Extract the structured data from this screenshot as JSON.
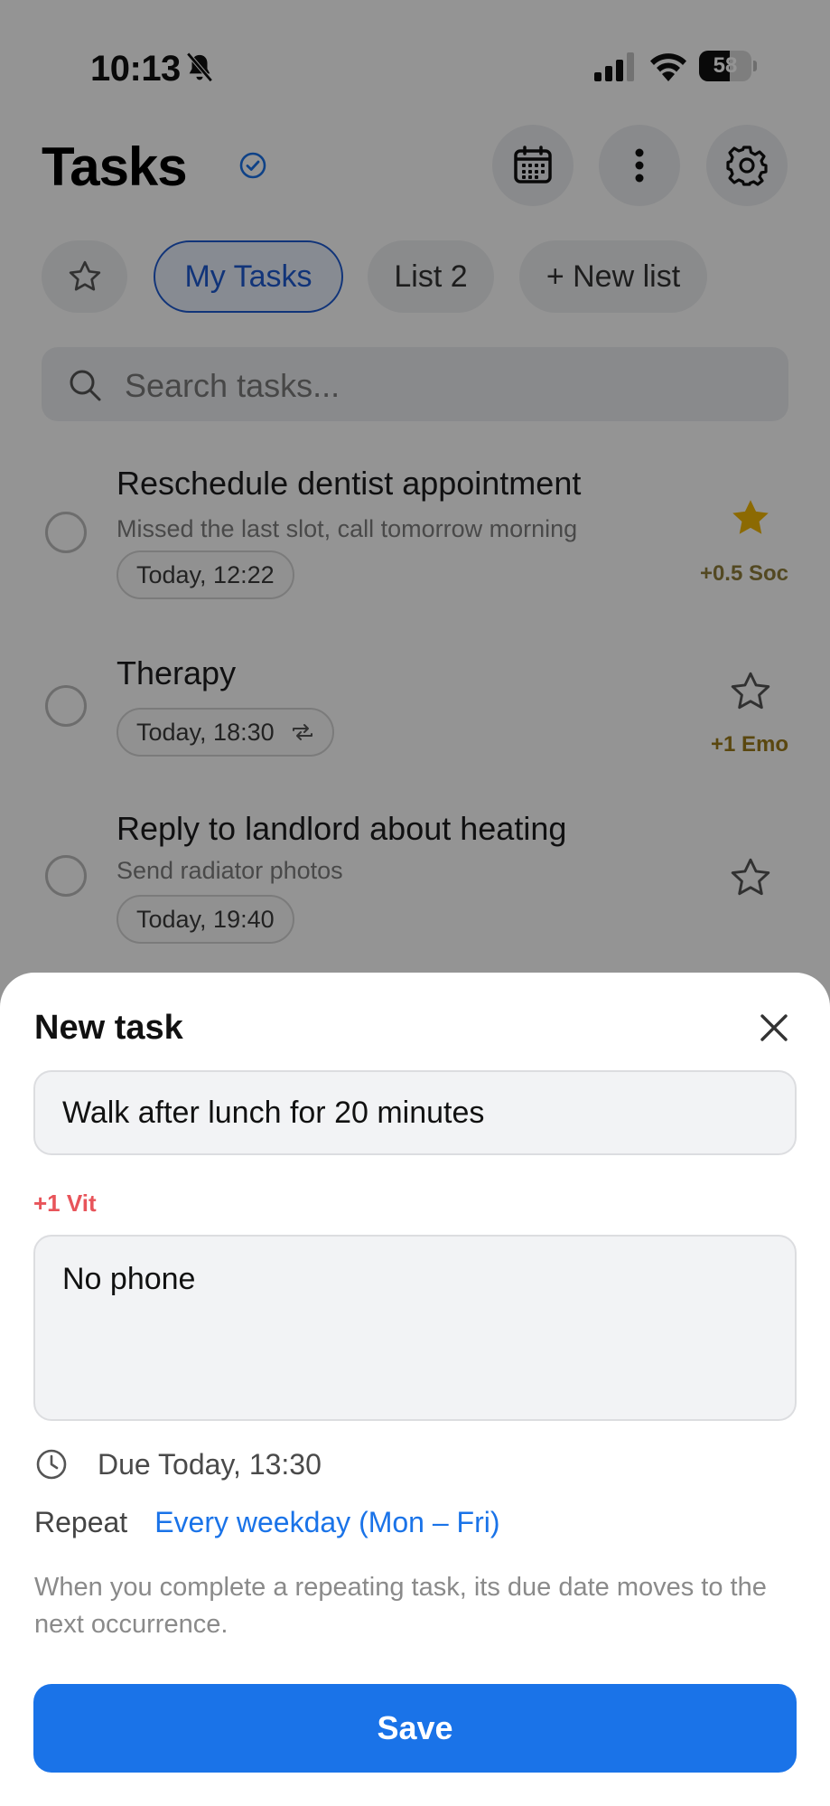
{
  "status_bar": {
    "time": "10:13",
    "battery_percent": "58",
    "battery_level": 0.58
  },
  "header": {
    "title": "Tasks"
  },
  "lists": {
    "favorites_icon": "star-outline-icon",
    "items": [
      {
        "label": "My Tasks",
        "active": true
      },
      {
        "label": "List 2",
        "active": false
      }
    ],
    "new_list_label": "+ New list"
  },
  "search": {
    "placeholder": "Search tasks..."
  },
  "tasks": [
    {
      "title": "Reschedule dentist appointment",
      "note": "Missed the last slot, call tomorrow morning",
      "due": "Today, 12:22",
      "starred": true,
      "reward": "+0.5 Soc",
      "reward_color": "#8f7e3c"
    },
    {
      "title": "Therapy",
      "note": "",
      "due": "Today, 18:30",
      "repeats": true,
      "starred": false,
      "reward": "+1 Emo",
      "reward_color": "#9b7a1a"
    },
    {
      "title": "Reply to landlord about heating",
      "note": "Send radiator photos",
      "due": "Today, 19:40",
      "starred": false,
      "reward": ""
    }
  ],
  "new_task_sheet": {
    "title": "New task",
    "task_title_value": "Walk after lunch for 20 minutes",
    "reward_tag": "+1 Vit",
    "notes_value": "No phone",
    "due_text": "Due Today, 13:30",
    "repeat_label": "Repeat",
    "repeat_value": "Every weekday (Mon – Fri)",
    "repeat_help": "When you complete a repeating task, its due date moves to the next occurrence.",
    "save_label": "Save"
  },
  "colors": {
    "accent": "#1a73e8",
    "active_chip": "#1e5bd1",
    "star_filled": "#f2b705",
    "reward_vit": "#e8545a"
  }
}
